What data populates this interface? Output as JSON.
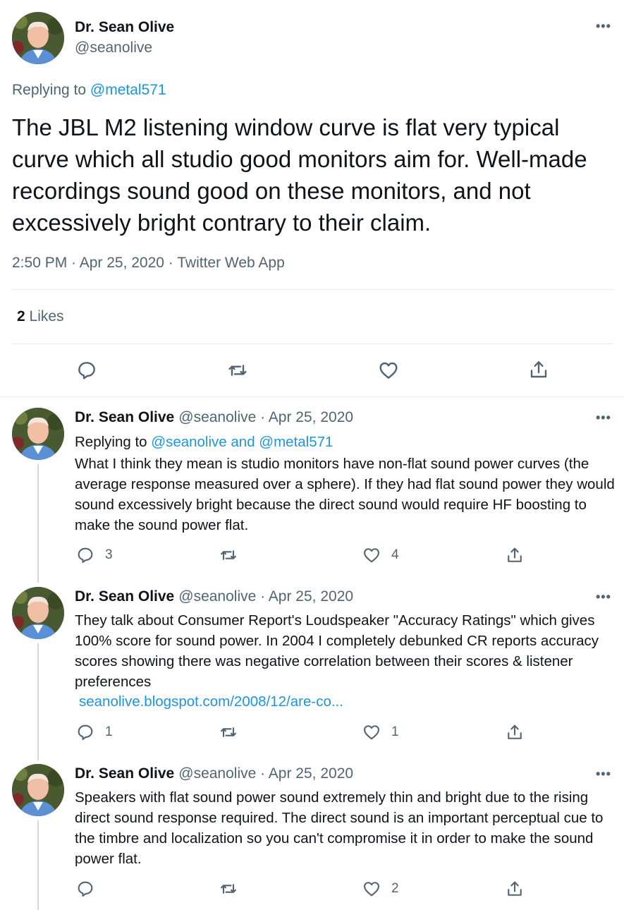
{
  "main_tweet": {
    "author": "Dr. Sean Olive",
    "handle": "@seanolive",
    "replying_prefix": "Replying to",
    "replying_to": "@metal571",
    "text": "The JBL M2 listening window curve is flat very typical curve which all studio good monitors aim for. Well-made recordings sound good on these monitors, and not excessively bright contrary to their claim.",
    "timestamp": "2:50 PM · Apr 25, 2020 · Twitter Web App",
    "likes_count": "2",
    "likes_label": "Likes",
    "more_label": "•••"
  },
  "replies": [
    {
      "author": "Dr. Sean Olive",
      "handle_date": "@seanolive · Apr 25, 2020",
      "replying_prefix": "Replying to",
      "replying_to": "@seanolive and @metal571",
      "text": "What I think they mean is  studio monitors have non-flat sound power curves (the average response measured over a sphere). If they had flat sound power they would sound excessively bright because the direct sound would require HF boosting to make the sound power flat.",
      "replies": "3",
      "likes": "4",
      "more_label": "•••"
    },
    {
      "author": "Dr. Sean Olive",
      "handle_date": "@seanolive · Apr 25, 2020",
      "text": "They talk about Consumer Report's Loudspeaker \"Accuracy Ratings\" which gives 100%  score for sound power. In 2004 I completely debunked CR reports accuracy scores showing there was negative correlation between their scores & listener preferences",
      "link": "seanolive.blogspot.com/2008/12/are-co...",
      "replies": "1",
      "likes": "1",
      "more_label": "•••"
    },
    {
      "author": "Dr. Sean Olive",
      "handle_date": "@seanolive · Apr 25, 2020",
      "text": "Speakers with flat sound power sound extremely thin and bright due to the rising direct sound response required. The direct sound is an important perceptual cue to the timbre and localization so you can't compromise it  in order to make the sound power flat.",
      "replies": "",
      "likes": "2",
      "more_label": "•••"
    }
  ],
  "icons": [
    "reply-icon",
    "retweet-icon",
    "like-icon",
    "share-icon",
    "more-icon",
    "avatar"
  ],
  "colors": {
    "link": "#1b95e0",
    "muted": "#536471",
    "text": "#0f1419",
    "divider": "#e6ecf0"
  }
}
